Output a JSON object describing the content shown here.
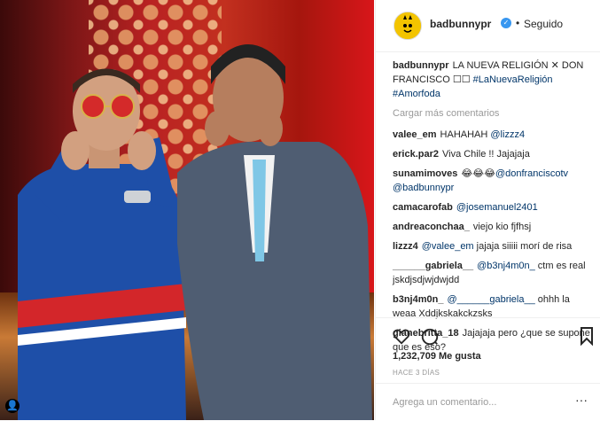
{
  "post": {
    "username": "badbunnypr",
    "follow_status": "Seguido",
    "dot": "•",
    "caption_text": "LA NUEVA RELIGIÓN ✕ DON FRANCISCO ☐☐ #LaNuevaReligión #Amorfoda",
    "load_more": "Cargar más comentarios",
    "likes": "1,232,709 Me gusta",
    "time_ago": "HACE 3 DÍAS",
    "add_comment_placeholder": "Agrega un comentario...",
    "more": "···"
  },
  "comments": [
    {
      "user": "valee_em",
      "text": "HAHAHAH @lizzz4"
    },
    {
      "user": "erick.par2",
      "text": "Viva Chile !! Jajajaja"
    },
    {
      "user": "sunamimoves",
      "text": "😂😂😂@donfranciscotv @badbunnypr"
    },
    {
      "user": "camacarofab",
      "text": "@josemanuel2401"
    },
    {
      "user": "andreaconchaa_",
      "text": "viejo kio fjfhsj"
    },
    {
      "user": "lizzz4",
      "text": "@valee_em jajaja siiiii morí de risa"
    },
    {
      "user": "______gabriela__",
      "text": "@b3nj4m0n_ ctm es real jskdjsdjwjdwjdd"
    },
    {
      "user": "b3nj4m0n_",
      "text": "@______gabriela__ ohhh la weaa Xddjkskakckzsks"
    },
    {
      "user": "gianebritta_18",
      "text": "Jajajaja pero ¿que se supone que es eso?"
    }
  ],
  "icons": {
    "heart": "heart-icon",
    "comment": "comment-icon",
    "bookmark": "bookmark-icon",
    "verified": "verified-badge-icon"
  },
  "colors": {
    "verified_blue": "#3897f0",
    "avatar_yellow": "#f3c400",
    "muted": "#999999"
  }
}
